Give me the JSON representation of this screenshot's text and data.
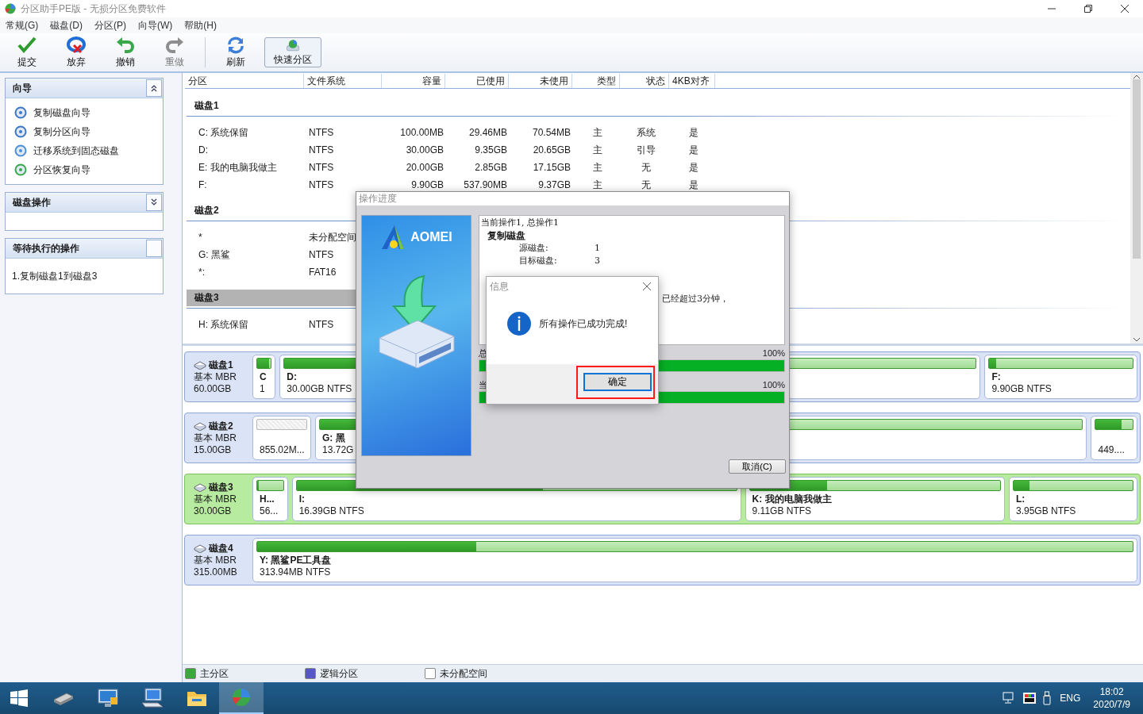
{
  "window": {
    "title": "分区助手PE版 - 无损分区免费软件"
  },
  "menu": [
    "常规(G)",
    "磁盘(D)",
    "分区(P)",
    "向导(W)",
    "帮助(H)"
  ],
  "toolbar": {
    "groups": [
      [
        {
          "label": "提交",
          "kind": "commit",
          "disabled": false,
          "framed": false
        },
        {
          "label": "放弃",
          "kind": "discard",
          "disabled": false,
          "framed": false
        },
        {
          "label": "撤销",
          "kind": "undo",
          "disabled": false,
          "framed": false
        },
        {
          "label": "重做",
          "kind": "redo",
          "disabled": true,
          "framed": false
        }
      ],
      [
        {
          "label": "刷新",
          "kind": "refresh",
          "disabled": false,
          "framed": false
        },
        {
          "label": "快速分区",
          "kind": "quick",
          "disabled": false,
          "framed": true
        }
      ]
    ]
  },
  "sidebar": {
    "sections": [
      {
        "title": "向导",
        "kind": "open",
        "items": [
          {
            "label": "复制磁盘向导",
            "kind": "copy-disk"
          },
          {
            "label": "复制分区向导",
            "kind": "copy-part"
          },
          {
            "label": "迁移系统到固态磁盘",
            "kind": "migrate"
          },
          {
            "label": "分区恢复向导",
            "kind": "recover"
          }
        ]
      },
      {
        "title": "磁盘操作",
        "kind": "closed"
      },
      {
        "title": "等待执行的操作",
        "kind": "plain",
        "items": [
          {
            "label": "1.复制磁盘1到磁盘3",
            "kind": "text"
          }
        ]
      }
    ]
  },
  "table": {
    "columns": [
      "分区",
      "文件系统",
      "容量",
      "已使用",
      "未使用",
      "类型",
      "状态",
      "4KB对齐"
    ],
    "disks": [
      {
        "name": "磁盘1",
        "selected": false,
        "rows": [
          [
            "C: 系统保留",
            "NTFS",
            "100.00MB",
            "29.46MB",
            "70.54MB",
            "主",
            "系统",
            "是"
          ],
          [
            "D:",
            "NTFS",
            "30.00GB",
            "9.35GB",
            "20.65GB",
            "主",
            "引导",
            "是"
          ],
          [
            "E: 我的电脑我做主",
            "NTFS",
            "20.00GB",
            "2.85GB",
            "17.15GB",
            "主",
            "无",
            "是"
          ],
          [
            "F:",
            "NTFS",
            "9.90GB",
            "537.90MB",
            "9.37GB",
            "主",
            "无",
            "是"
          ]
        ]
      },
      {
        "name": "磁盘2",
        "selected": false,
        "rows": [
          [
            "*",
            "未分配空间"
          ],
          [
            "G: 黑鲨",
            "NTFS"
          ],
          [
            "*:",
            "FAT16"
          ]
        ]
      },
      {
        "name": "磁盘3",
        "selected": true,
        "rows": [
          [
            "H: 系统保留",
            "NTFS"
          ]
        ]
      }
    ]
  },
  "disk_map": [
    {
      "name": "磁盘1",
      "type": "基本 MBR",
      "size": "60.00GB",
      "selected": false,
      "partitions": [
        {
          "kind": "primary",
          "label": "C",
          "size": "1",
          "level": 0.9
        },
        {
          "kind": "primary",
          "label": "D:",
          "size": "30.00GB NTFS",
          "level": 0.31
        },
        {
          "kind": "primary"
        },
        {
          "kind": "primary",
          "label": "F:",
          "size": "9.90GB NTFS",
          "level": 0.05
        }
      ]
    },
    {
      "name": "磁盘2",
      "type": "基本 MBR",
      "size": "15.00GB",
      "selected": false,
      "partitions": [
        {
          "kind": "unallocated",
          "size": "855.02M..."
        },
        {
          "kind": "primary",
          "label": "G: 黑",
          "size": "13.72G",
          "level": 0.1
        },
        {
          "kind": "primary",
          "size": "449....",
          "level": 0.7
        }
      ]
    },
    {
      "name": "磁盘3",
      "type": "基本 MBR",
      "size": "30.00GB",
      "selected": true,
      "partitions": [
        {
          "kind": "primary",
          "label": "H...",
          "size": "56...",
          "level": 0.05
        },
        {
          "kind": "primary",
          "label": "I:",
          "size": "16.39GB NTFS",
          "level": 0.56
        },
        {
          "kind": "primary",
          "label": "K: 我的电脑我做主",
          "size": "9.11GB NTFS",
          "level": 0.31
        },
        {
          "kind": "primary",
          "label": "L:",
          "size": "3.95GB NTFS",
          "level": 0.13
        }
      ]
    },
    {
      "name": "磁盘4",
      "type": "基本 MBR",
      "size": "315.00MB",
      "selected": false,
      "partitions": [
        {
          "kind": "primary",
          "label": "Y: 黑鲨PE工具盘",
          "size": "313.94MB NTFS",
          "level": 0.25
        }
      ]
    }
  ],
  "legend": [
    {
      "label": "主分区",
      "color": "#3aa83a"
    },
    {
      "label": "逻辑分区",
      "color": "#5656c4"
    },
    {
      "label": "未分配空间",
      "color": "#ffffff"
    }
  ],
  "progress_dialog": {
    "title": "操作进度",
    "logo": "AOMEI",
    "log": [
      {
        "kind": "plain",
        "text": "当前操作1, 总操作1"
      },
      {
        "kind": "heading",
        "text": "复制磁盘"
      },
      {
        "kind": "pair",
        "key": "源磁盘:",
        "value": "1"
      },
      {
        "kind": "pair",
        "key": "目标磁盘:",
        "value": "3"
      },
      {
        "kind": "continued",
        "text": "已经超过3分钟，"
      }
    ],
    "progress": [
      {
        "label": "总",
        "reading": "100%",
        "level": 1
      },
      {
        "label": "当",
        "reading": "100%",
        "level": 1
      }
    ],
    "cancel": "取消(C)"
  },
  "info_dialog": {
    "title": "信息",
    "message": "所有操作已成功完成!",
    "ok": "确定",
    "highlighted": true
  },
  "taskbar": {
    "apps": [
      {
        "kind": "drive",
        "active": false
      },
      {
        "kind": "computer",
        "active": false
      },
      {
        "kind": "keyboard",
        "active": false
      },
      {
        "kind": "folder",
        "active": false
      },
      {
        "kind": "partition",
        "active": true
      }
    ],
    "language": "ENG",
    "time": "18:02",
    "date": "2020/7/9"
  }
}
